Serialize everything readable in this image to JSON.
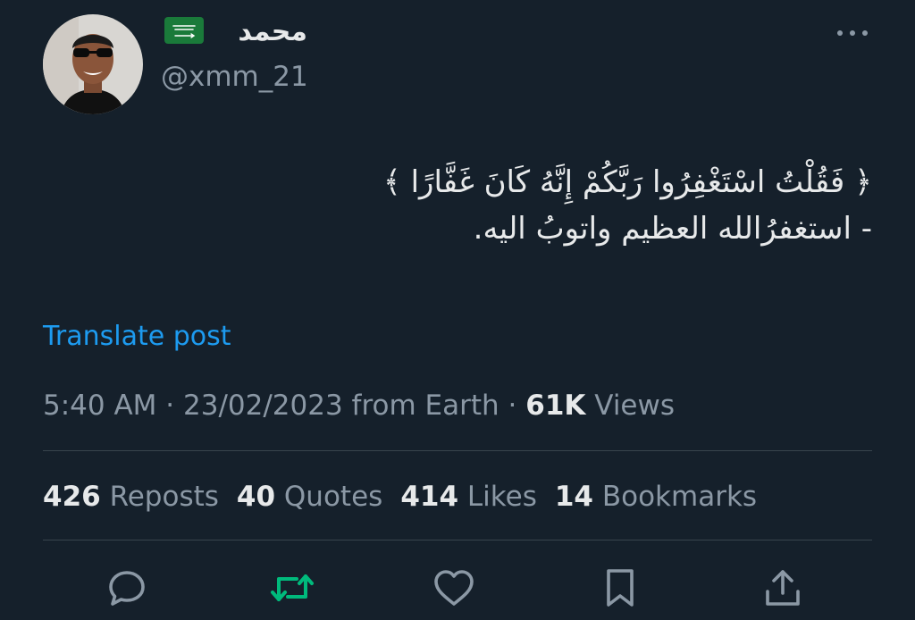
{
  "user": {
    "display_name": "محمد",
    "handle": "@xmm_21",
    "flag_icon": "saudi-arabia-flag"
  },
  "tweet": {
    "lines": [
      "﴿ فَقُلْتُ اسْتَغْفِرُوا رَبَّكُمْ إِنَّهُ كَانَ غَفَّارًا ﴾",
      "- استغفرُالله العظيم واتوبُ اليه."
    ],
    "translate_label": "Translate post"
  },
  "meta": {
    "time": "5:40 AM",
    "date": "23/02/2023",
    "source": "from Earth",
    "separator": "·",
    "views_count": "61K",
    "views_label": "Views"
  },
  "stats": {
    "reposts_count": "426",
    "reposts_label": "Reposts",
    "quotes_count": "40",
    "quotes_label": "Quotes",
    "likes_count": "414",
    "likes_label": "Likes",
    "bookmarks_count": "14",
    "bookmarks_label": "Bookmarks"
  },
  "actions": {
    "icons": [
      "reply-icon",
      "repost-icon",
      "like-icon",
      "bookmark-icon",
      "share-icon"
    ],
    "repost_color": "#00ba7c",
    "icon_color": "#8b98a5"
  },
  "colors": {
    "background": "#15202b",
    "text": "#e7e9ea",
    "muted": "#8b98a5",
    "link": "#1d9bf0",
    "divider": "#38444d"
  }
}
